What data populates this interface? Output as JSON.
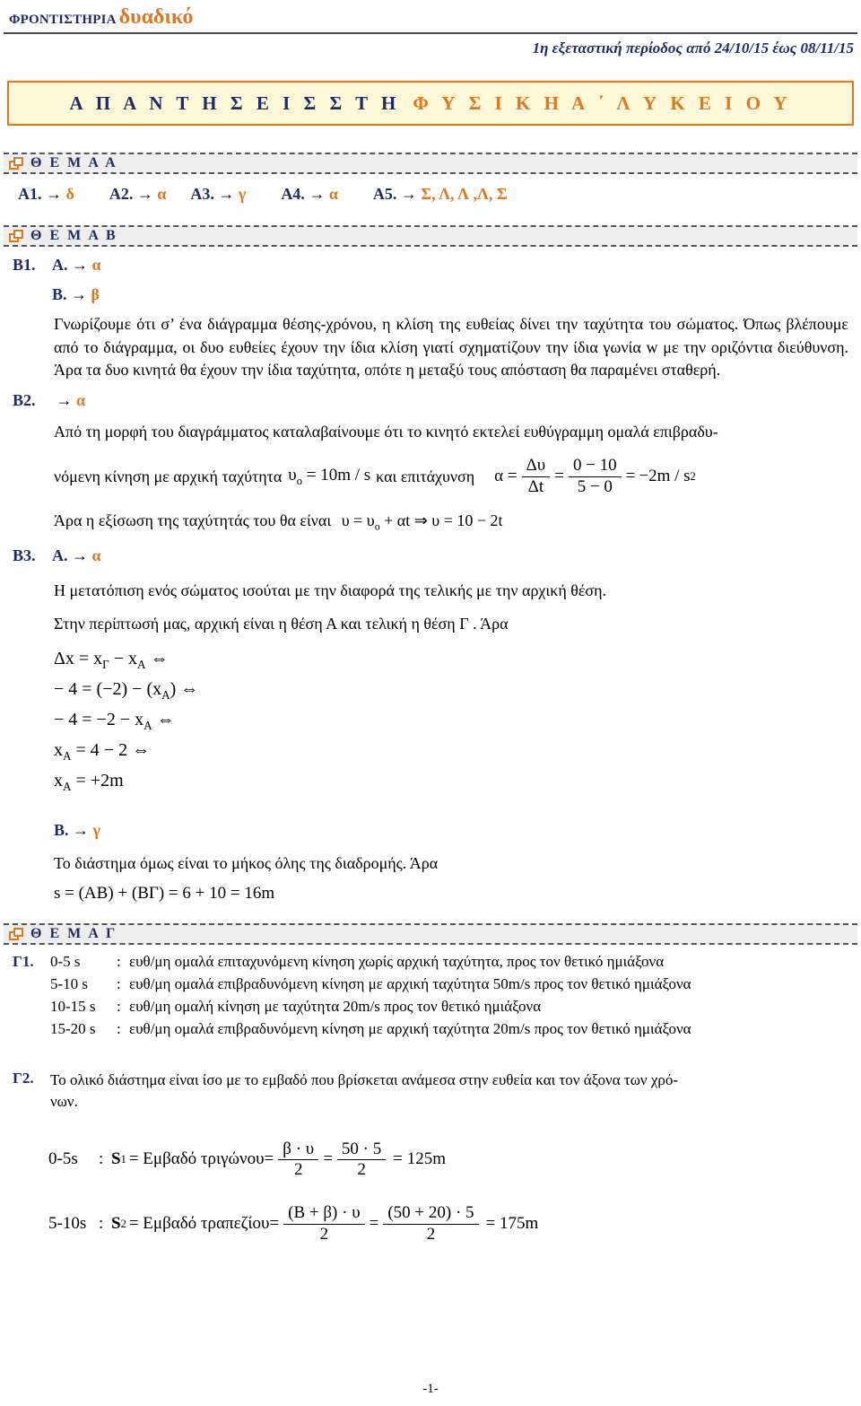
{
  "masthead": {
    "brand_prefix": "ΦΡΟΝΤΙΣΤΗΡΙΑ",
    "brand_name": "δυαδικό",
    "exam_period": "1η εξεταστική περίοδος από 24/10/15 έως 08/11/15"
  },
  "title_banner": {
    "part_dark": "Α Π Α Ν Τ Η Σ Ε Ι Σ   Σ Τ Η",
    "part_orange": "Φ Υ Σ Ι Κ Η   Α ΄   Λ Υ Κ Ε Ι Ο Υ"
  },
  "colors": {
    "navy": "#1f2a66",
    "orange": "#e2761b",
    "banner_bg": "#fdf8d8",
    "bar_bg": "#eeeeee"
  },
  "section_a": {
    "icon": "cascade-windows-icon",
    "title": "Θ Ε Μ Α  Α",
    "answers": [
      {
        "label": "Α1.",
        "arrow": "→",
        "value": "δ"
      },
      {
        "label": "Α2.",
        "arrow": "→",
        "value": "α"
      },
      {
        "label": "Α3.",
        "arrow": "→",
        "value": "γ"
      },
      {
        "label": "Α4.",
        "arrow": "→",
        "value": "α"
      },
      {
        "label": "Α5.",
        "arrow": "→",
        "value": "Σ, Λ, Λ ,Λ, Σ"
      }
    ]
  },
  "section_b": {
    "icon": "cascade-windows-icon",
    "title": "Θ Ε Μ Α  Β",
    "b1": {
      "label": "Β1.",
      "sub_a_label": "Α.",
      "sub_a_arrow": "→",
      "sub_a_value": "α",
      "sub_b_label": "Β.",
      "sub_b_arrow": "→",
      "sub_b_value": "β",
      "paragraph": "Γνωρίζουμε ότι σ’ ένα διάγραμμα θέσης-χρόνου, η κλίση της ευθείας δίνει την ταχύτητα του σώματος. Όπως βλέπουμε από το διάγραμμα, οι δυο ευθείες έχουν την ίδια κλίση γιατί σχηματίζουν την ίδια γωνία w με την οριζόντια διεύθυνση. Άρα τα δυο κινητά θα έχουν την ίδια ταχύτητα, οπότε η μεταξύ τους απόσταση θα παραμένει σταθερή."
    },
    "b2": {
      "label": "Β2.",
      "arrow": "→",
      "value": "α",
      "text_1": "Από τη μορφή του διαγράμματος καταλαβαίνουμε ότι το κινητό εκτελεί ευθύγραμμη ομαλά επιβραδυ-",
      "text_2": "νόμενη κίνηση με αρχική ταχύτητα",
      "v0_expr": "υ",
      "v0_sub": "ο",
      "v0_value": "= 10m / s",
      "text_3": "και επιτάχυνση",
      "accel_symbol": "α =",
      "frac1_num": "Δυ",
      "frac1_den": "Δt",
      "eq1": "=",
      "frac2_num": "0 − 10",
      "frac2_den": "5 − 0",
      "eq2": "=",
      "accel_result": "−2m / s",
      "accel_exp": "2",
      "text_4": "Άρα η εξίσωση της ταχύτητάς του θα είναι",
      "eq_v": "υ = υ",
      "eq_v_sub": "ο",
      "eq_v_rest": "+ αt ⇒ υ = 10 − 2t"
    },
    "b3": {
      "label": "Β3.",
      "sub_a_label": "Α.",
      "sub_a_arrow": "→",
      "sub_a_value": "α",
      "text_1": "Η μετατόπιση ενός σώματος  ισούται με την διαφορά της τελικής με την αρχική θέση.",
      "text_2": "Στην περίπτωσή μας, αρχική είναι η θέση Α και τελική η θέση Γ . Άρα",
      "equations": [
        "Δx = x_Γ − x_Α ⇔",
        "− 4 = (−2) − (x_Α) ⇔",
        "− 4 = −2 − x_Α ⇔",
        "x_Α = 4 − 2 ⇔",
        "x_Α = +2m"
      ],
      "sub_b_label": "Β.",
      "sub_b_arrow": "→",
      "sub_b_value": "γ",
      "text_3": "Το διάστημα όμως είναι το μήκος όλης της διαδρομής. Άρα",
      "eq_s": "s = (ΑΒ) + (ΒΓ) = 6 + 10 = 16m"
    }
  },
  "section_g": {
    "icon": "cascade-windows-icon",
    "title": "Θ Ε Μ Α  Γ",
    "g1": {
      "label": "Γ1.",
      "rows": [
        {
          "time": "0-5 s",
          "colon": ":",
          "desc": "ευθ/μη ομαλά επιταχυνόμενη κίνηση χωρίς αρχική ταχύτητα, προς τον θετικό ημιάξονα"
        },
        {
          "time": "5-10 s",
          "colon": ":",
          "desc": "ευθ/μη ομαλά επιβραδυνόμενη κίνηση με αρχική ταχύτητα 50m/s προς τον θετικό ημιάξονα"
        },
        {
          "time": "10-15 s",
          "colon": ":",
          "desc": "ευθ/μη ομαλή κίνηση  με ταχύτητα 20m/s προς τον θετικό ημιάξονα"
        },
        {
          "time": "15-20 s",
          "colon": ":",
          "desc": "ευθ/μη ομαλά επιβραδυνόμενη κίνηση με αρχική ταχύτητα 20m/s προς τον θετικό ημιάξονα"
        }
      ]
    },
    "g2": {
      "label": "Γ2.",
      "text_1": "Το ολικό διάστημα είναι ίσο με το  εμβαδό που βρίσκεται ανάμεσα στην ευθεία και τον άξονα των χρό-",
      "text_2": "νων.",
      "calc_1": {
        "range": "0-5s",
        "colon": ":",
        "symbol": "S",
        "symbol_sub": "1",
        "equals": "= Εμβαδό τριγώνου=",
        "frac1_num": "β · υ",
        "frac1_den": "2",
        "eq": "=",
        "frac2_num": "50 · 5",
        "frac2_den": "2",
        "result": "= 125m"
      },
      "calc_2": {
        "range": "5-10s",
        "colon": ":",
        "symbol": "S",
        "symbol_sub": "2",
        "equals": "= Εμβαδό τραπεζίου=",
        "frac1_num": "(Β + β) · υ",
        "frac1_den": "2",
        "eq": "=",
        "frac2_num": "(50 + 20) · 5",
        "frac2_den": "2",
        "result": "= 175m"
      }
    }
  },
  "footer": {
    "page_number": "-1-"
  }
}
